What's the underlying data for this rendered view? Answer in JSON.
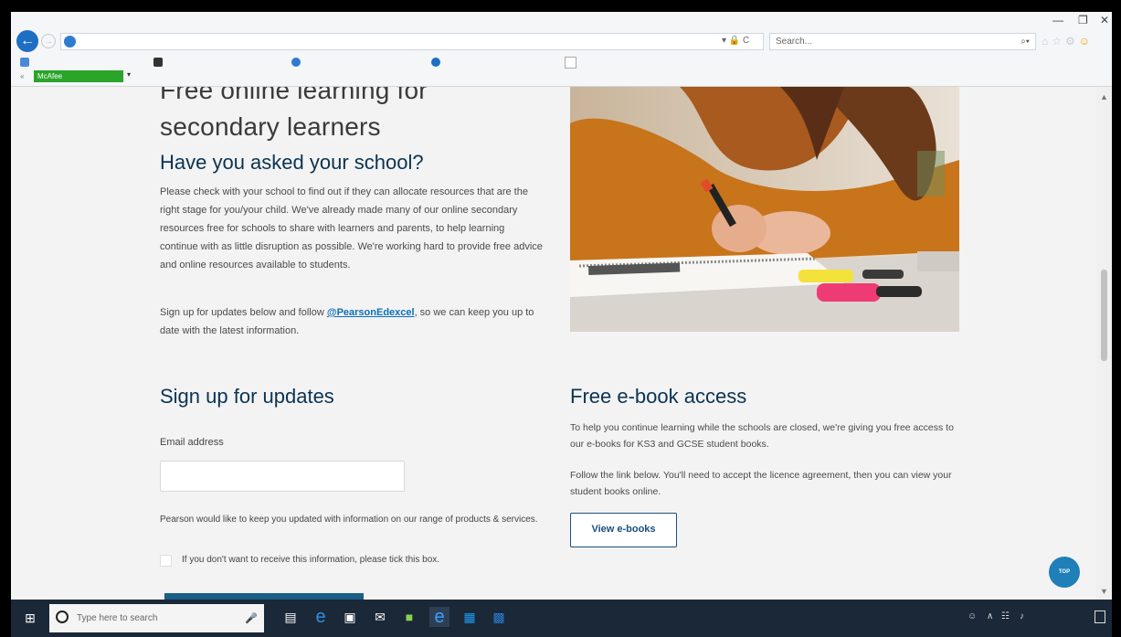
{
  "browser": {
    "url": "",
    "search_placeholder": "Search...",
    "search_icon": "search-icon",
    "address_controls": "▾ 🔒 C",
    "window_controls": {
      "minimize": "—",
      "restore": "❐",
      "close": "✕"
    },
    "favorites": [
      {
        "label": "",
        "color": "#4a8ad8"
      },
      {
        "label": "",
        "color": "#333333"
      },
      {
        "label": "",
        "color": "#2f7bd0"
      },
      {
        "label": "",
        "color": "#1e6ec4"
      }
    ],
    "mcafee_label": "McAfee",
    "mcafee_dropdown": "▾"
  },
  "page": {
    "hero_title": "Free online learning for secondary learners",
    "school_heading": "Have you asked your school?",
    "school_paragraph": "Please check with your school to find out if they can allocate resources that are the right stage for you/your child. We've already made many of our online secondary resources free for schools to share with learners and parents, to help learning continue with as little disruption as possible. We're working hard to provide free advice and online resources available to students.",
    "follow_prefix": "Sign up for updates below and follow ",
    "follow_link": "@PearsonEdexcel",
    "follow_suffix": ", so we can keep you up to date with the latest information.",
    "signup_heading": "Sign up for updates",
    "email_label": "Email address",
    "email_value": "",
    "consent_text": "Pearson would like to keep you updated with information on our range of products & services.",
    "checkbox_label": "If you don't want to receive this information, please tick this box.",
    "submit_label": "",
    "ebook_heading": "Free e-book access",
    "ebook_paragraph_1": "To help you continue learning while the schools are closed, we're giving you free access to our e-books for KS3 and GCSE student books.",
    "ebook_paragraph_2": "Follow the link below. You'll need to accept the licence agreement, then you can view your student books online.",
    "view_button": "View e-books",
    "top_button": "TOP"
  },
  "taskbar": {
    "search_placeholder": "Type here to search",
    "time": "",
    "date": ""
  },
  "colors": {
    "heading": "#0b3353",
    "link": "#0d6fb8",
    "button_border": "#1a4f80",
    "top_button": "#1f7fb8",
    "taskbar": "#1b2838"
  }
}
